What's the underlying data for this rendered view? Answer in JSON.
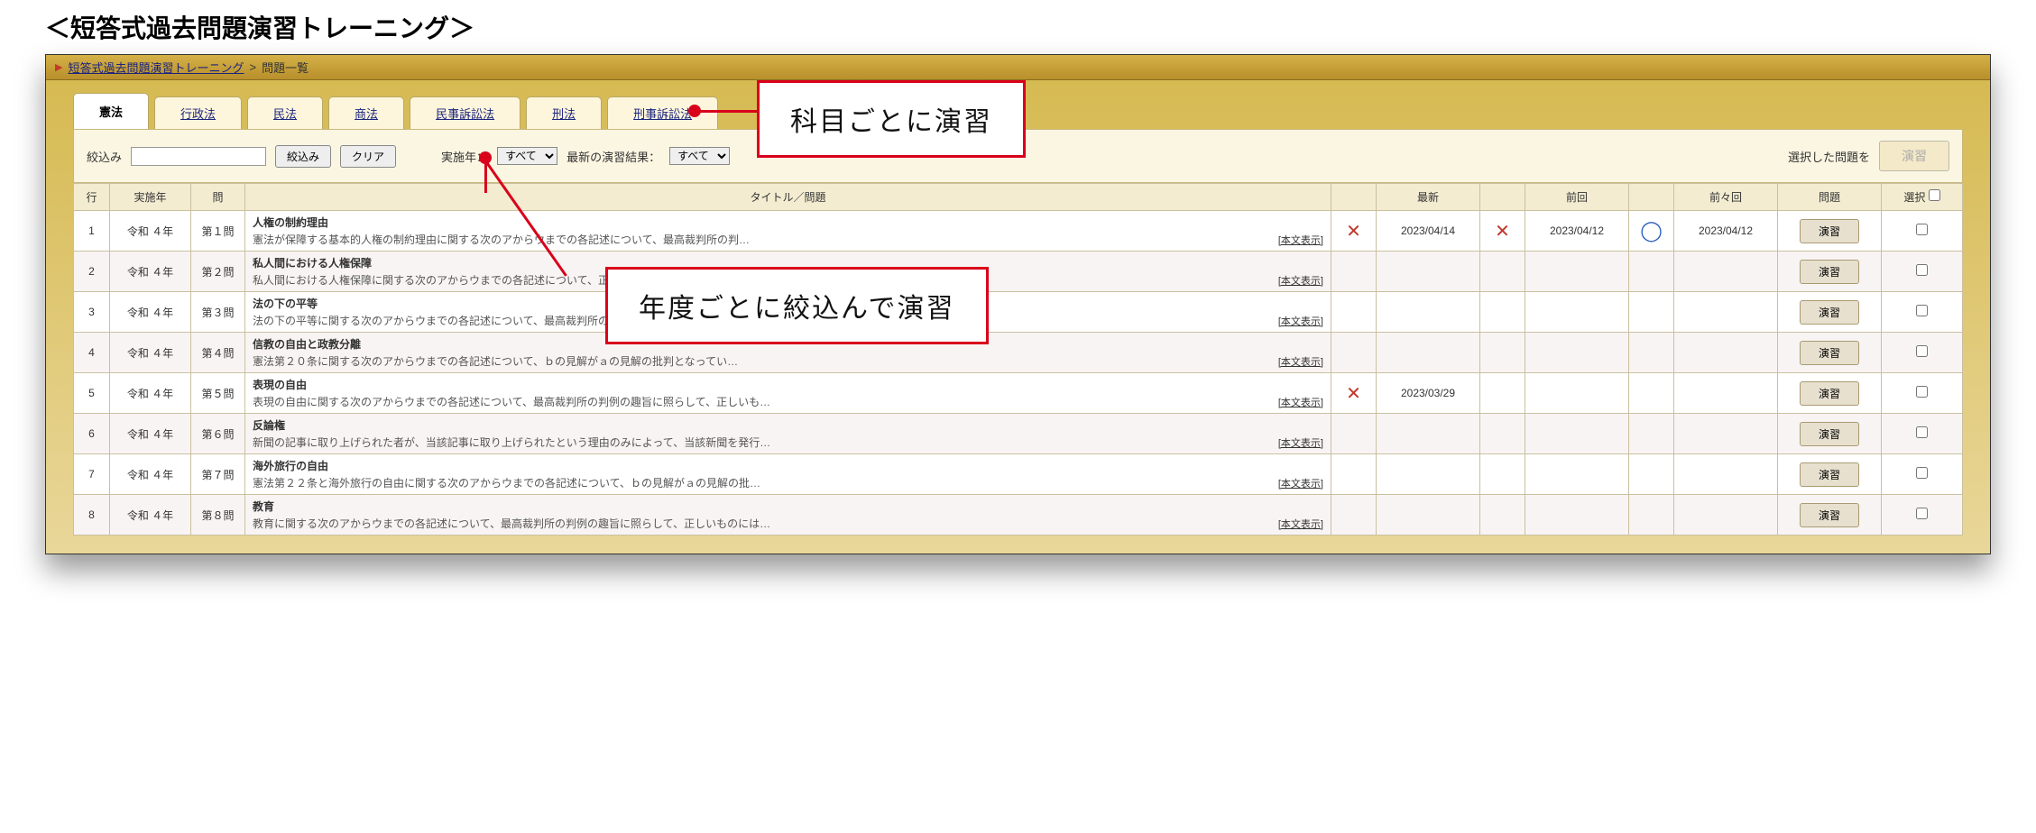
{
  "page_title": "＜短答式過去問題演習トレーニング＞",
  "breadcrumb": {
    "link": "短答式過去問題演習トレーニング",
    "sep": ">",
    "current": "問題一覧"
  },
  "tabs": [
    {
      "label": "憲法",
      "active": true
    },
    {
      "label": "行政法",
      "active": false
    },
    {
      "label": "民法",
      "active": false
    },
    {
      "label": "商法",
      "active": false
    },
    {
      "label": "民事訴訟法",
      "active": false
    },
    {
      "label": "刑法",
      "active": false
    },
    {
      "label": "刑事訴訟法",
      "active": false
    }
  ],
  "controls": {
    "filter_label": "絞込み",
    "filter_btn": "絞込み",
    "clear_btn": "クリア",
    "year_label": "実施年：",
    "year_value": "すべて",
    "result_label": "最新の演習結果：",
    "result_value": "すべて",
    "selected_label": "選択した問題を",
    "practice_btn": "演習"
  },
  "headers": {
    "row": "行",
    "year": "実施年",
    "q": "問",
    "title": "タイトル／問題",
    "latest": "最新",
    "prev": "前回",
    "prev2": "前々回",
    "problem": "問題",
    "select": "選択"
  },
  "show_full": "[本文表示]",
  "row_practice": "演習",
  "rows": [
    {
      "idx": "1",
      "year": "令和 ４年",
      "q": "第１問",
      "title": "人権の制約理由",
      "desc": "憲法が保障する基本的人権の制約理由に関する次のアからウまでの各記述について、最高裁判所の判…",
      "latest_mark": "x",
      "latest_date": "2023/04/14",
      "prev_mark": "x",
      "prev_date": "2023/04/12",
      "prev2_mark": "o",
      "prev2_date": "2023/04/12"
    },
    {
      "idx": "2",
      "year": "令和 ４年",
      "q": "第２問",
      "title": "私人間における人権保障",
      "desc": "私人間における人権保障に関する次のアからウまでの各記述について、正しいものには○、誤って…",
      "latest_mark": "",
      "latest_date": "",
      "prev_mark": "",
      "prev_date": "",
      "prev2_mark": "",
      "prev2_date": ""
    },
    {
      "idx": "3",
      "year": "令和 ４年",
      "q": "第３問",
      "title": "法の下の平等",
      "desc": "法の下の平等に関する次のアからウまでの各記述について、最高裁判所の判例の趣旨に照らして…",
      "latest_mark": "",
      "latest_date": "",
      "prev_mark": "",
      "prev_date": "",
      "prev2_mark": "",
      "prev2_date": ""
    },
    {
      "idx": "4",
      "year": "令和 ４年",
      "q": "第４問",
      "title": "信教の自由と政教分離",
      "desc": "憲法第２０条に関する次のアからウまでの各記述について、ｂの見解がａの見解の批判となってい…",
      "latest_mark": "",
      "latest_date": "",
      "prev_mark": "",
      "prev_date": "",
      "prev2_mark": "",
      "prev2_date": ""
    },
    {
      "idx": "5",
      "year": "令和 ４年",
      "q": "第５問",
      "title": "表現の自由",
      "desc": "表現の自由に関する次のアからウまでの各記述について、最高裁判所の判例の趣旨に照らして、正しいも…",
      "latest_mark": "x",
      "latest_date": "2023/03/29",
      "prev_mark": "",
      "prev_date": "",
      "prev2_mark": "",
      "prev2_date": ""
    },
    {
      "idx": "6",
      "year": "令和 ４年",
      "q": "第６問",
      "title": "反論権",
      "desc": "新聞の記事に取り上げられた者が、当該記事に取り上げられたという理由のみによって、当該新聞を発行…",
      "latest_mark": "",
      "latest_date": "",
      "prev_mark": "",
      "prev_date": "",
      "prev2_mark": "",
      "prev2_date": ""
    },
    {
      "idx": "7",
      "year": "令和 ４年",
      "q": "第７問",
      "title": "海外旅行の自由",
      "desc": "憲法第２２条と海外旅行の自由に関する次のアからウまでの各記述について、ｂの見解がａの見解の批…",
      "latest_mark": "",
      "latest_date": "",
      "prev_mark": "",
      "prev_date": "",
      "prev2_mark": "",
      "prev2_date": ""
    },
    {
      "idx": "8",
      "year": "令和 ４年",
      "q": "第８問",
      "title": "教育",
      "desc": "教育に関する次のアからウまでの各記述について、最高裁判所の判例の趣旨に照らして、正しいものには…",
      "latest_mark": "",
      "latest_date": "",
      "prev_mark": "",
      "prev_date": "",
      "prev2_mark": "",
      "prev2_date": ""
    }
  ],
  "callouts": {
    "subject": "科目ごとに演習",
    "year": "年度ごとに絞込んで演習"
  }
}
